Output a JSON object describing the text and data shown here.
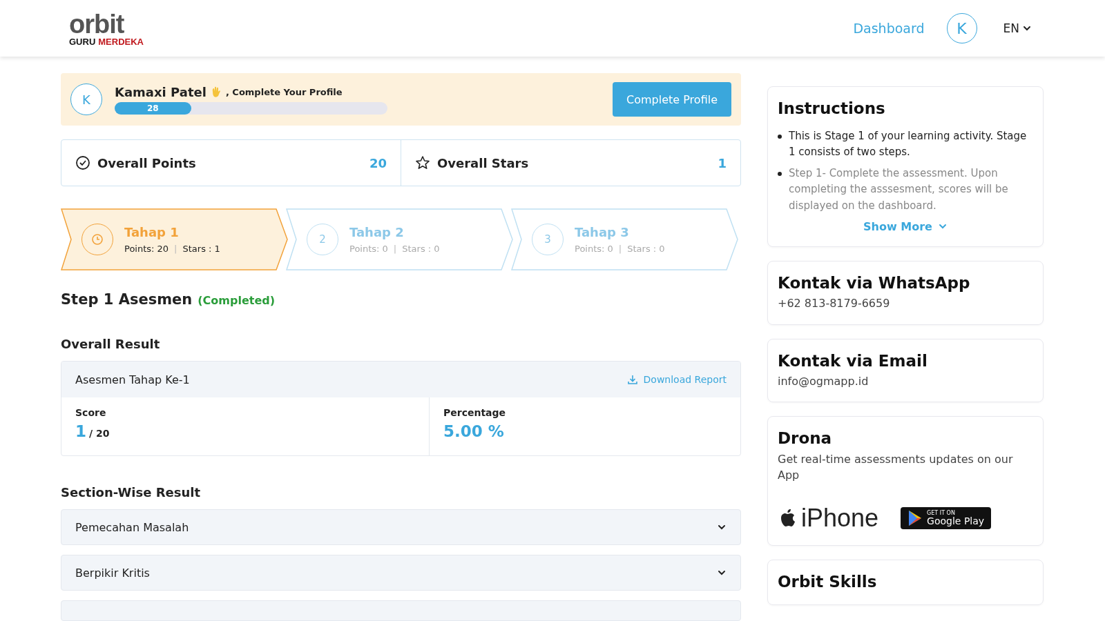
{
  "header": {
    "logo": {
      "word": "orbit",
      "sub_1": "GURU",
      "sub_2": "MERDEKA"
    },
    "nav_link": "Dashboard",
    "avatar": "K",
    "language": "EN"
  },
  "profile": {
    "avatar": "K",
    "name": "Kamaxi Patel",
    "prompt": ", Complete Your Profile",
    "progress": {
      "level": 0.28,
      "label": "28"
    },
    "button": "Complete Profile"
  },
  "stats": [
    {
      "kind": "points",
      "label": "Overall Points",
      "value": "20"
    },
    {
      "kind": "stars",
      "label": "Overall Stars",
      "value": "1"
    }
  ],
  "stages": [
    {
      "title": "Tahap 1",
      "points": "Points: 20",
      "divider": "|",
      "stars": "Stars : 1",
      "selected": true
    },
    {
      "badge": "2",
      "title": "Tahap 2",
      "points": "Points: 0",
      "divider": "|",
      "stars": "Stars : 0",
      "selected": false
    },
    {
      "badge": "3",
      "title": "Tahap 3",
      "points": "Points: 0",
      "divider": "|",
      "stars": "Stars : 0",
      "selected": false
    }
  ],
  "step": {
    "title": "Step 1 Asesmen",
    "status": "(Completed)"
  },
  "overall_result": {
    "heading": "Overall Result",
    "card_title": "Asesmen Tahap Ke-1",
    "download": "Download Report",
    "score_label": "Score",
    "score": "1",
    "score_total": "/ 20",
    "percentage_label": "Percentage",
    "percentage": "5.00 %"
  },
  "section_result": {
    "heading": "Section-Wise Result",
    "sections": [
      {
        "title": "Pemecahan Masalah",
        "expanded": false
      },
      {
        "title": "Berpikir Kritis",
        "expanded": false
      }
    ]
  },
  "sidebar": {
    "instructions": {
      "title": "Instructions",
      "items": [
        "This is Stage 1 of your learning activity. Stage 1 consists of two steps.",
        "Step 1- Complete the assessment. Upon completing the asssesment, scores will be displayed on the dashboard."
      ],
      "show_more": "Show More"
    },
    "cards": [
      {
        "kind": "contact",
        "title": "Kontak via WhatsApp",
        "text": "+62 813-8179-6659"
      },
      {
        "kind": "contact",
        "title": "Kontak via Email",
        "text": "info@ogmapp.id"
      },
      {
        "kind": "app",
        "title": "Drona",
        "text": "Get real-time assessments updates on our App",
        "iphone": "iPhone",
        "play_small": "GET IT ON",
        "play_big": "Google Play"
      },
      {
        "kind": "app_cut",
        "title": "Orbit Skills"
      }
    ]
  }
}
